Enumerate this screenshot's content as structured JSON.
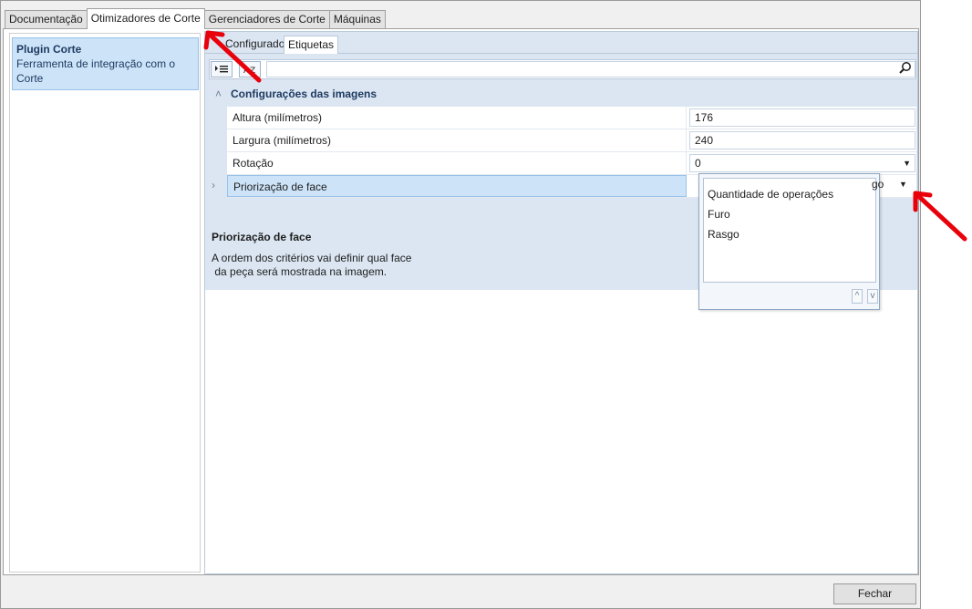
{
  "tabs": [
    {
      "label": "Documentação"
    },
    {
      "label": "Otimizadores de Corte"
    },
    {
      "label": "Gerenciadores de Corte"
    },
    {
      "label": "Máquinas"
    }
  ],
  "plugin": {
    "title": "Plugin Corte",
    "description_line1": "Ferramenta de integração com o",
    "description_line2": "Corte"
  },
  "inner_tabs": [
    {
      "label": "Configurador"
    },
    {
      "label": "Etiquetas"
    }
  ],
  "toolbar": {
    "categorized_icon": "categorized-icon",
    "alphabetical_icon": "sort-az-icon",
    "search_value": ""
  },
  "category": {
    "label": "Configurações das imagens"
  },
  "properties": [
    {
      "name": "Altura (milímetros)",
      "value": "176"
    },
    {
      "name": "Largura (milímetros)",
      "value": "240"
    },
    {
      "name": "Rotação",
      "value": "0"
    },
    {
      "name": "Priorização de face",
      "value": "go"
    }
  ],
  "description": {
    "title": "Priorização de face",
    "line1": "A ordem dos critérios vai definir qual face",
    "line2": " da peça será mostrada na imagem."
  },
  "popup": {
    "items": [
      "Quantidade de operações",
      "Furo",
      "Rasgo"
    ],
    "up_label": "^",
    "down_label": "v"
  },
  "footer": {
    "close_label": "Fechar"
  },
  "colors": {
    "accent": "#cde3f8",
    "panel": "#dbe6f2",
    "annotation_arrow": "#e8000b"
  }
}
